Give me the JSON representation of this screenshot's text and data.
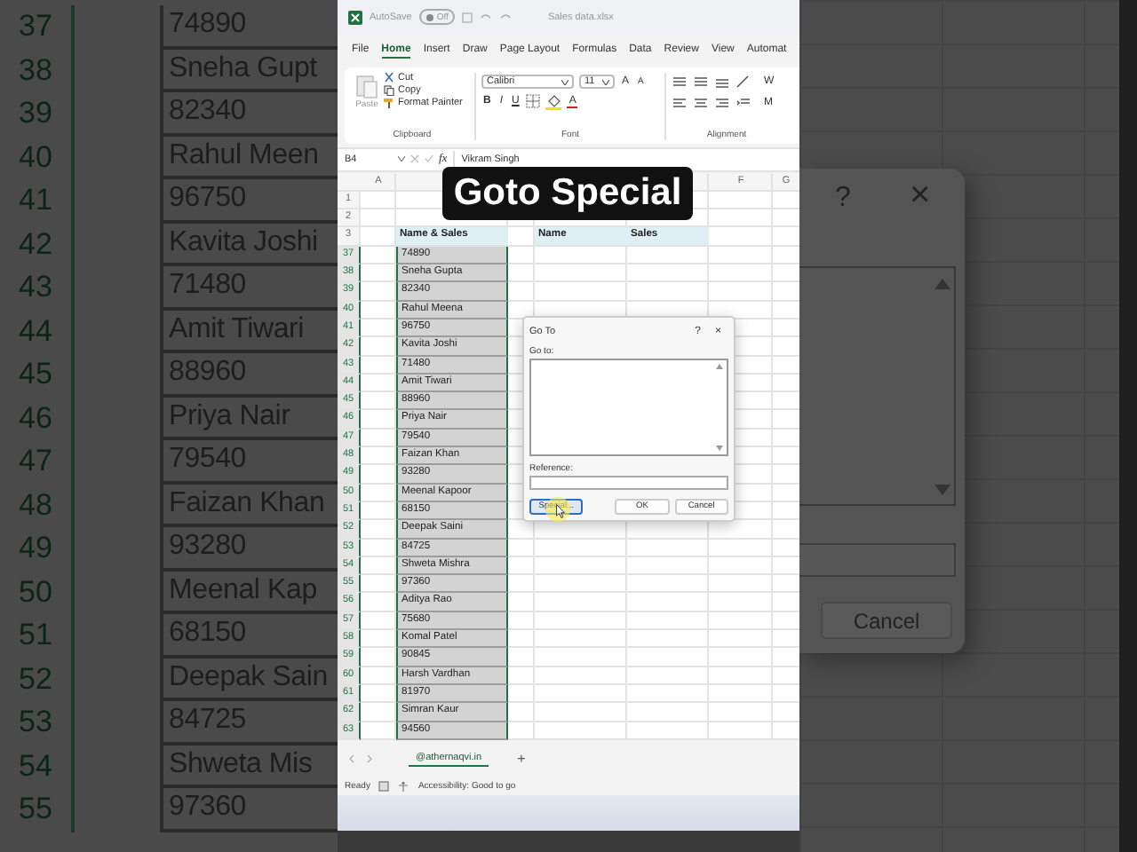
{
  "backdrop_left": {
    "rows": [
      {
        "num": "37",
        "value": "74890"
      },
      {
        "num": "38",
        "value": "Sneha Gupt"
      },
      {
        "num": "39",
        "value": "82340"
      },
      {
        "num": "40",
        "value": "Rahul Meen"
      },
      {
        "num": "41",
        "value": "96750"
      },
      {
        "num": "42",
        "value": "Kavita Joshi"
      },
      {
        "num": "43",
        "value": "71480"
      },
      {
        "num": "44",
        "value": "Amit Tiwari"
      },
      {
        "num": "45",
        "value": "88960"
      },
      {
        "num": "46",
        "value": "Priya Nair"
      },
      {
        "num": "47",
        "value": "79540"
      },
      {
        "num": "48",
        "value": "Faizan Khan"
      },
      {
        "num": "49",
        "value": "93280"
      },
      {
        "num": "50",
        "value": "Meenal Kap"
      },
      {
        "num": "51",
        "value": "68150"
      },
      {
        "num": "52",
        "value": "Deepak Sain"
      },
      {
        "num": "53",
        "value": "84725"
      },
      {
        "num": "54",
        "value": "Shweta Mis"
      },
      {
        "num": "55",
        "value": "97360"
      }
    ]
  },
  "backdrop_right": {
    "dialog": {
      "help": "?",
      "close": "×",
      "cancel": "Cancel"
    }
  },
  "caption": "Goto Special",
  "excel": {
    "title_bar": {
      "autosave": "AutoSave",
      "autosave_state": "Off",
      "autosave_on": false,
      "file_name": "Sales data.xlsx"
    },
    "tabs": [
      {
        "label": "File",
        "selected": false
      },
      {
        "label": "Home",
        "selected": true
      },
      {
        "label": "Insert",
        "selected": false
      },
      {
        "label": "Draw",
        "selected": false
      },
      {
        "label": "Page Layout",
        "selected": false
      },
      {
        "label": "Formulas",
        "selected": false
      },
      {
        "label": "Data",
        "selected": false
      },
      {
        "label": "Review",
        "selected": false
      },
      {
        "label": "View",
        "selected": false
      },
      {
        "label": "Automat",
        "selected": false
      }
    ],
    "ribbon": {
      "clipboard": {
        "paste": "Paste",
        "cut": "Cut",
        "copy": "Copy",
        "format_painter": "Format Painter",
        "label": "Clipboard"
      },
      "font": {
        "family": "Calibri",
        "size": "11",
        "grow": "A",
        "shrink": "A",
        "styles": [
          "B",
          "I",
          "U"
        ],
        "font_color": "A",
        "label": "Font"
      },
      "alignment": {
        "label": "Alignment",
        "cut_off": [
          "W",
          "M"
        ]
      }
    },
    "formula_bar": {
      "name_box": "B4",
      "fx": "fx",
      "value": "Vikram Singh"
    },
    "sheet": {
      "columns": [
        "A",
        "F",
        "G"
      ],
      "top_rows": [
        {
          "num": "1"
        },
        {
          "num": "2"
        }
      ],
      "header_row": {
        "num": "3",
        "b": "Name & Sales",
        "d": "Name",
        "e": "Sales"
      },
      "rows": [
        {
          "num": "37",
          "value": "74890",
          "selected": true
        },
        {
          "num": "38",
          "value": "Sneha Gupta",
          "selected": true
        },
        {
          "num": "39",
          "value": "82340",
          "selected": true
        },
        {
          "num": "40",
          "value": "Rahul Meena",
          "selected": true
        },
        {
          "num": "41",
          "value": "96750",
          "selected": true
        },
        {
          "num": "42",
          "value": "Kavita Joshi",
          "selected": true
        },
        {
          "num": "43",
          "value": "71480",
          "selected": true
        },
        {
          "num": "44",
          "value": "Amit Tiwari",
          "selected": true
        },
        {
          "num": "45",
          "value": "88960",
          "selected": true
        },
        {
          "num": "46",
          "value": "Priya Nair",
          "selected": true
        },
        {
          "num": "47",
          "value": "79540",
          "selected": true
        },
        {
          "num": "48",
          "value": "Faizan Khan",
          "selected": true
        },
        {
          "num": "49",
          "value": "93280",
          "selected": true
        },
        {
          "num": "50",
          "value": "Meenal Kapoor",
          "selected": true
        },
        {
          "num": "51",
          "value": "68150",
          "selected": true
        },
        {
          "num": "52",
          "value": "Deepak Saini",
          "selected": true
        },
        {
          "num": "53",
          "value": "84725",
          "selected": true
        },
        {
          "num": "54",
          "value": "Shweta Mishra",
          "selected": true
        },
        {
          "num": "55",
          "value": "97360",
          "selected": true
        },
        {
          "num": "56",
          "value": "Aditya Rao",
          "selected": true
        },
        {
          "num": "57",
          "value": "75680",
          "selected": true
        },
        {
          "num": "58",
          "value": "Komal Patel",
          "selected": true
        },
        {
          "num": "59",
          "value": "90845",
          "selected": true
        },
        {
          "num": "60",
          "value": "Harsh Vardhan",
          "selected": true
        },
        {
          "num": "61",
          "value": "81970",
          "selected": true
        },
        {
          "num": "62",
          "value": "Simran Kaur",
          "selected": true
        },
        {
          "num": "63",
          "value": "94560",
          "selected": true
        }
      ]
    },
    "dialog": {
      "title": "Go To",
      "help": "?",
      "close": "×",
      "goto_label": "Go to:",
      "reference_label": "Reference:",
      "buttons": [
        {
          "label": "Special...",
          "focused": true
        },
        {
          "label": "OK",
          "focused": false
        },
        {
          "label": "Cancel",
          "focused": false
        }
      ]
    },
    "sheet_tabs": [
      {
        "label": "@athernaqvi.in",
        "selected": true
      }
    ],
    "add_sheet": "+",
    "status_bar": {
      "ready": "Ready",
      "accessibility": "Accessibility: Good to go"
    }
  }
}
